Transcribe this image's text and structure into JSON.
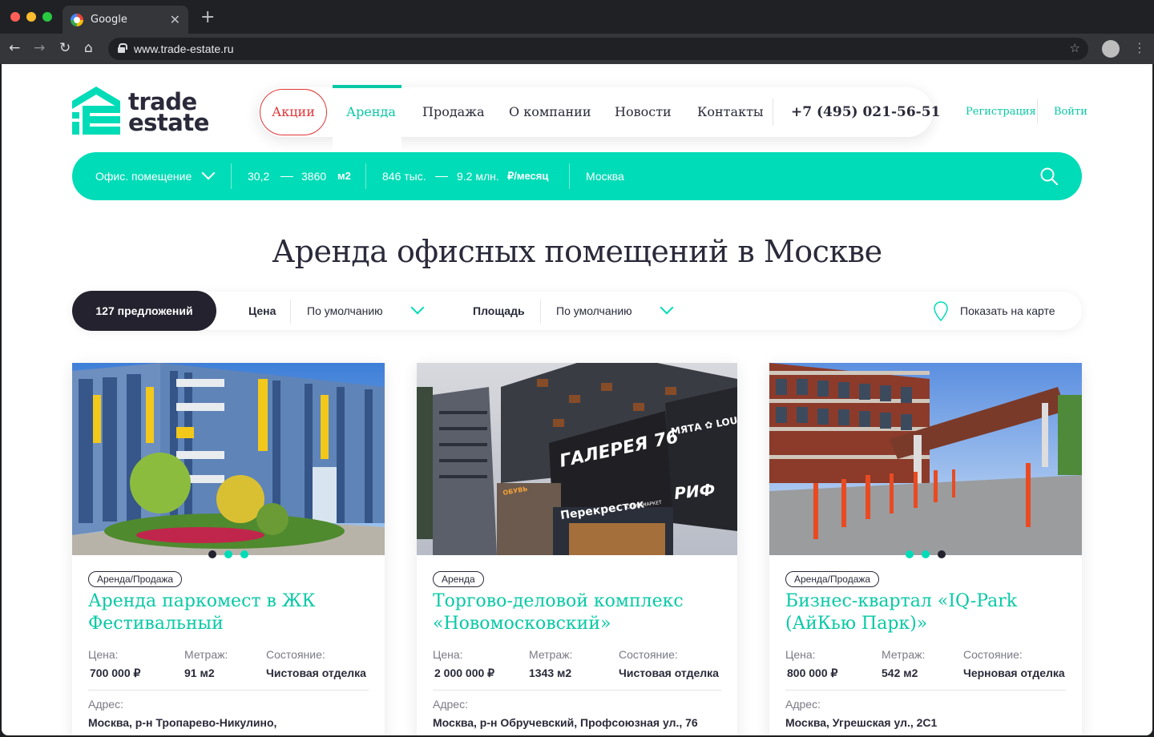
{
  "browser": {
    "tab_title": "Google",
    "tab_close": "✕",
    "new_tab": "+",
    "url": "www.trade-estate.ru",
    "back": "←",
    "forward": "→",
    "reload": "↻",
    "home": "⌂",
    "star": "☆",
    "menu": "⋮"
  },
  "logo": {
    "line1": "trade",
    "line2": "estate",
    "color": "#00dcb7"
  },
  "nav": {
    "promo": "Акции",
    "items": [
      "Аренда",
      "Продажа",
      "О компании",
      "Новости",
      "Контакты"
    ],
    "active_index": 0,
    "phone": "+7 (495) 021-56-51"
  },
  "auth": {
    "register": "Регистрация",
    "login": "Войти"
  },
  "search": {
    "type": "Офис. помещение",
    "area_from": "30,2",
    "area_to": "3860",
    "area_unit": "м2",
    "price_from": "846 тыс.",
    "price_to": "9.2 млн.",
    "price_unit": "₽/месяц",
    "city": "Москва"
  },
  "page_title": "Аренда офисных помещений в Москве",
  "filters": {
    "count": "127 предложений",
    "price_label": "Цена",
    "price_value": "По умолчанию",
    "area_label": "Площадь",
    "area_value": "По умолчанию",
    "map_link": "Показать на карте"
  },
  "labels": {
    "price": "Цена:",
    "area": "Метраж:",
    "condition": "Состояние:",
    "address": "Адрес:"
  },
  "cards": [
    {
      "badge": "Аренда/Продажа",
      "title_line1": "Аренда паркомест в ЖК",
      "title_line2": "Фестивальный",
      "price": "700 000 ₽",
      "area": "91 м2",
      "condition": "Чистовая отделка",
      "address": "Москва, р-н Тропарево-Никулино,",
      "active_dot": 0
    },
    {
      "badge": "Аренда",
      "title_line1": "Торгово-деловой комплекс",
      "title_line2": "«Новомосковский»",
      "price": "2 000 000 ₽",
      "area": "1343 м2",
      "condition": "Чистовая отделка",
      "address": "Москва, р-н Обручевский, Профсоюзная ул., 76",
      "sign_main": "ГАЛЕРЕЯ 76",
      "sign_store": "Перекресток",
      "sign_store_sub": "СУПЕРМАРКЕТ",
      "sign_cafe": "МЯТА ✿ LOUN",
      "sign_bank": "РИФ",
      "sign_shop": "ОБУВЬ"
    },
    {
      "badge": "Аренда/Продажа",
      "title_line1": "Бизнес-квартал «IQ-Park",
      "title_line2": "(АйКью Парк)»",
      "price": "800 000 ₽",
      "area": "542 м2",
      "condition": "Черновая отделка",
      "address": "Москва, Угрешская ул., 2С1",
      "active_dot": 2
    }
  ],
  "colors": {
    "accent": "#00dcb7",
    "accent_text": "#08c9a5",
    "dark": "#23222e",
    "promo": "#e03636"
  }
}
